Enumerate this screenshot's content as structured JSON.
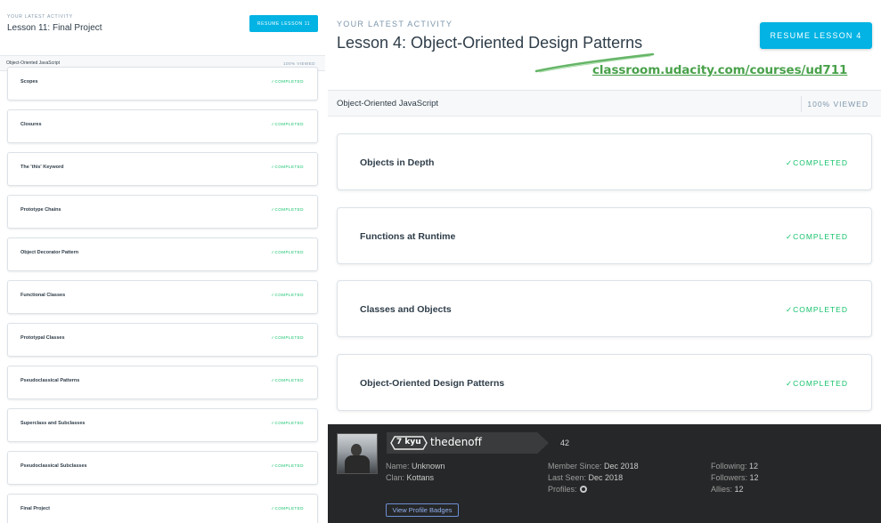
{
  "left": {
    "eyebrow": "YOUR LATEST ACTIVITY",
    "lesson_title": "Lesson 11: Final Project",
    "resume_label": "RESUME LESSON 11",
    "course_name": "Object-Oriented JavaScript",
    "viewed": "100% VIEWED",
    "lessons": [
      {
        "title": "Scopes",
        "status": "✓COMPLETED"
      },
      {
        "title": "Closures",
        "status": "✓COMPLETED"
      },
      {
        "title": "The 'this' Keyword",
        "status": "✓COMPLETED"
      },
      {
        "title": "Prototype Chains",
        "status": "✓COMPLETED"
      },
      {
        "title": "Object Decorator Pattern",
        "status": "✓COMPLETED"
      },
      {
        "title": "Functional Classes",
        "status": "✓COMPLETED"
      },
      {
        "title": "Prototypal Classes",
        "status": "✓COMPLETED"
      },
      {
        "title": "Pseudoclassical Patterns",
        "status": "✓COMPLETED"
      },
      {
        "title": "Superclass and Subclasses",
        "status": "✓COMPLETED"
      },
      {
        "title": "Pseudoclassical Subclasses",
        "status": "✓COMPLETED"
      },
      {
        "title": "Final Project",
        "status": "✓COMPLETED"
      }
    ]
  },
  "right": {
    "eyebrow": "YOUR LATEST ACTIVITY",
    "lesson_title": "Lesson 4: Object-Oriented Design Patterns",
    "resume_label": "RESUME LESSON 4",
    "url": "classroom.udacity.com/courses/ud711",
    "course_name": "Object-Oriented JavaScript",
    "viewed": "100% VIEWED",
    "lessons": [
      {
        "title": "Objects in Depth",
        "status": "✓COMPLETED"
      },
      {
        "title": "Functions at Runtime",
        "status": "✓COMPLETED"
      },
      {
        "title": "Classes and Objects",
        "status": "✓COMPLETED"
      },
      {
        "title": "Object-Oriented Design Patterns",
        "status": "✓COMPLETED"
      }
    ]
  },
  "codewars": {
    "rank": "7 kyu",
    "username": "thedenoff",
    "honor": "42",
    "name_label": "Name:",
    "name_value": "Unknown",
    "clan_label": "Clan:",
    "clan_value": "Kottans",
    "member_since_label": "Member Since:",
    "member_since_value": "Dec 2018",
    "last_seen_label": "Last Seen:",
    "last_seen_value": "Dec 2018",
    "profiles_label": "Profiles:",
    "following_label": "Following:",
    "following_value": "12",
    "followers_label": "Followers:",
    "followers_value": "12",
    "allies_label": "Allies:",
    "allies_value": "12",
    "badges_button": "View Profile Badges"
  },
  "colors": {
    "accent": "#02b3e4",
    "completed": "#15c26b",
    "url_green": "#48a14a",
    "codewars_bg": "#262728"
  },
  "icons": {
    "github": "github-icon",
    "avatar": "user-avatar"
  }
}
